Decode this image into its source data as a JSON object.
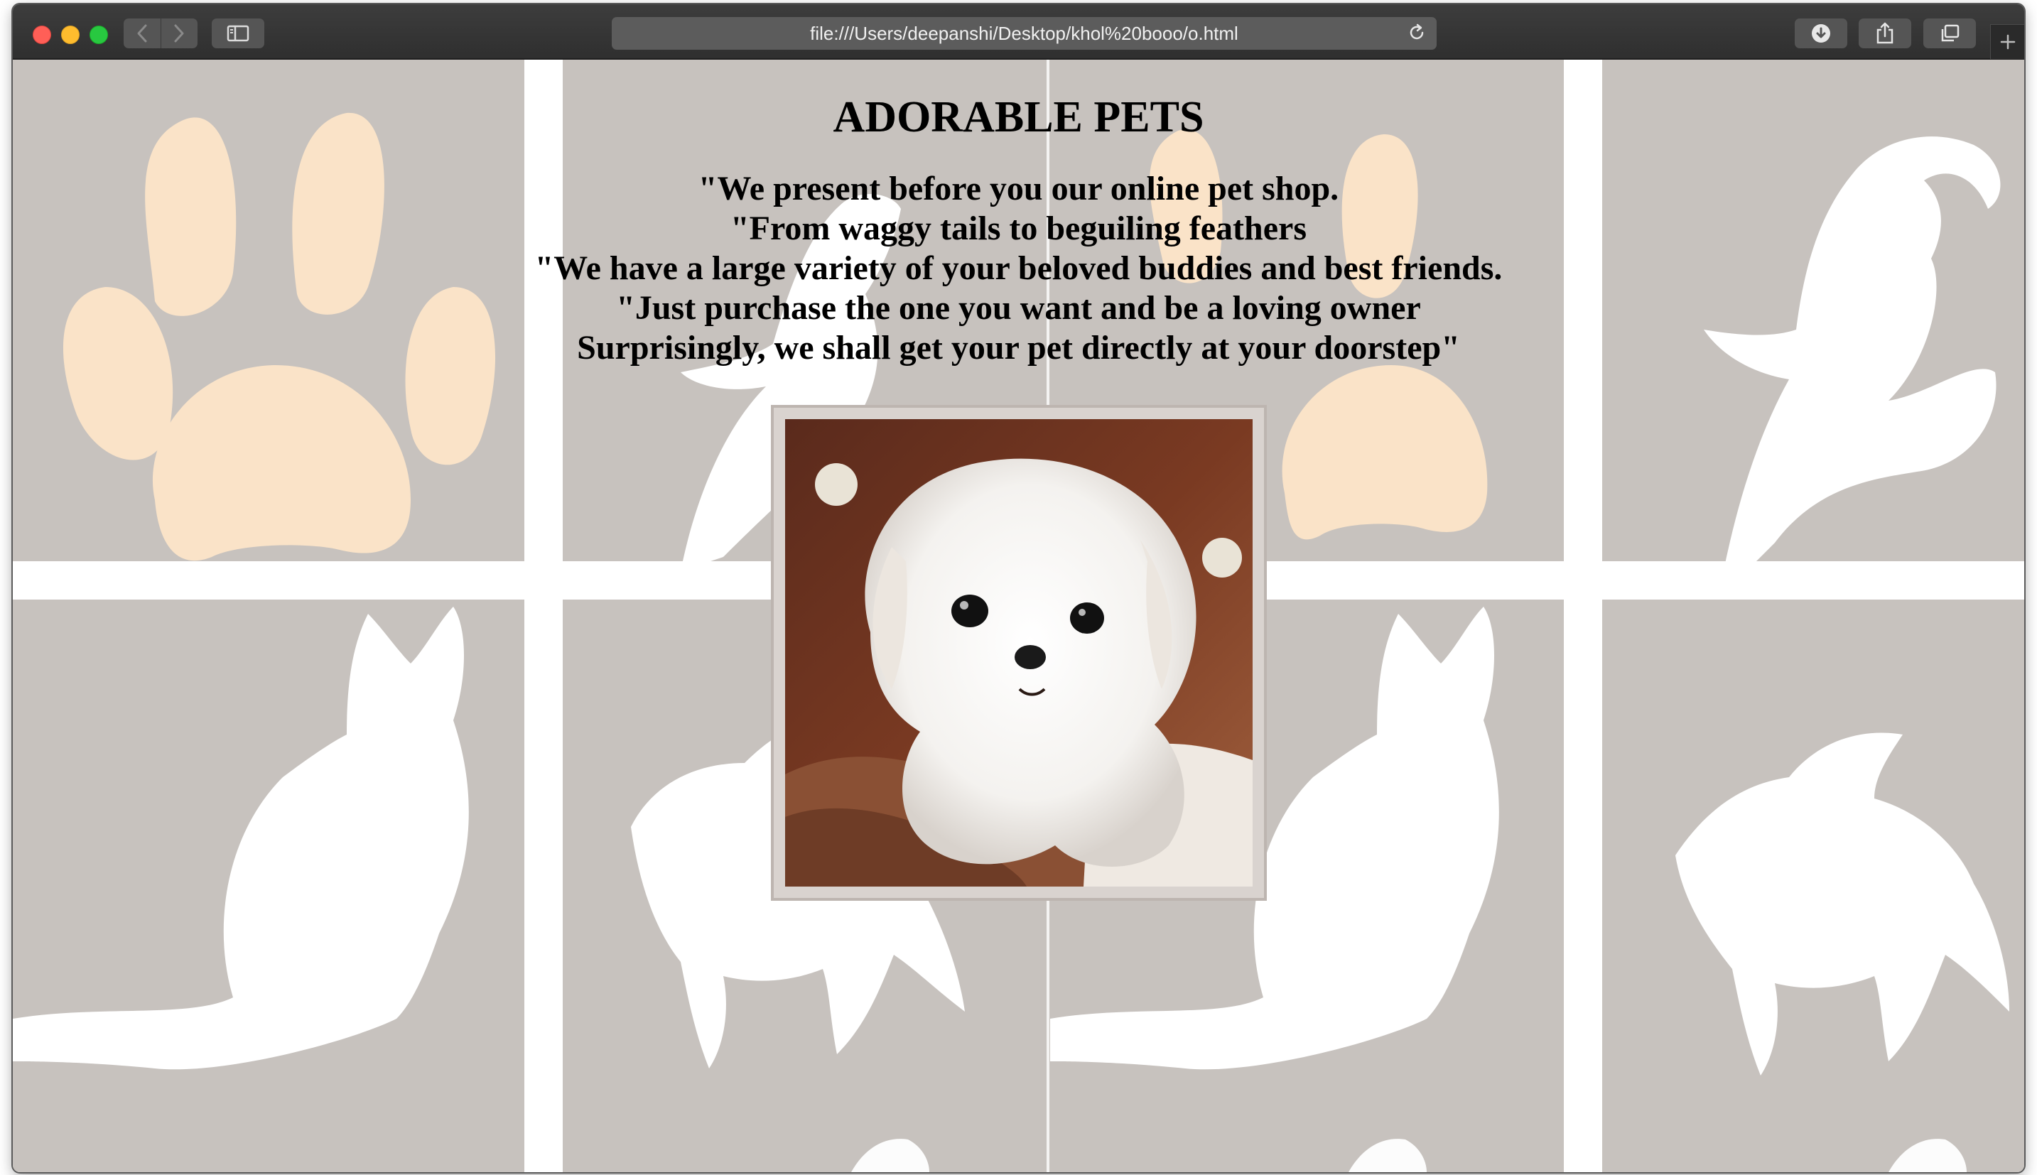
{
  "browser": {
    "url": "file:///Users/deepanshi/Desktop/khol%20booo/o.html"
  },
  "page": {
    "title": "ADORABLE PETS",
    "intro_lines": [
      "\"We present before you our online pet shop.",
      "\"From waggy tails to beguiling feathers",
      "\"We have a large variety of your beloved buddies and best friends.",
      "\"Just purchase the one you want and be a loving owner",
      "Surprisingly, we shall get your pet directly at your doorstep\""
    ]
  },
  "colors": {
    "page_background": "#c7c2be",
    "paw_color": "#fae3c8",
    "silhouette_color": "#ffffff"
  },
  "icons": {
    "back": "chevron-left-icon",
    "forward": "chevron-right-icon",
    "sidebar": "sidebar-icon",
    "reload": "reload-icon",
    "downloads": "download-icon",
    "share": "share-icon",
    "tabs": "tab-overview-icon",
    "new_tab": "plus-icon"
  }
}
